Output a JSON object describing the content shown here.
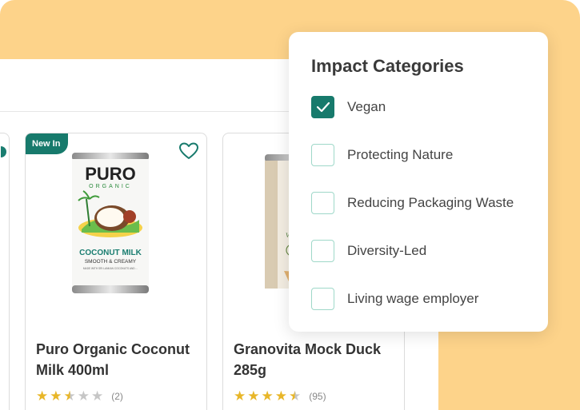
{
  "filter_popup": {
    "title": "Impact Categories",
    "options": [
      {
        "label": "Vegan",
        "checked": true
      },
      {
        "label": "Protecting Nature",
        "checked": false
      },
      {
        "label": "Reducing Packaging Waste",
        "checked": false
      },
      {
        "label": "Diversity-Led",
        "checked": false
      },
      {
        "label": "Living wage employer",
        "checked": false
      }
    ]
  },
  "products": [
    {
      "badge": "New In",
      "title_line1": "Puro Organic Coconut",
      "title_line2": "Milk 400ml",
      "rating": 2.5,
      "rating_count": "(2)",
      "can": {
        "brand": "PURO",
        "sub": "ORGANIC",
        "product": "COCONUT MILK",
        "tagline": "SMOOTH & CREAMY",
        "fineprint": "MADE WITH SRI LANKAN COCONUTS AND ..."
      }
    },
    {
      "title_line1": "Granovita Mock Duck",
      "title_line2": "285g",
      "rating": 4.5,
      "rating_count": "(95)",
      "can": {
        "label": "Vegan"
      }
    }
  ],
  "colors": {
    "accent": "#177a6c",
    "checkbox_border": "#9fd8c9",
    "background": "#fdd38a",
    "star": "#e8b628"
  },
  "icons": [
    "heart-icon",
    "check-icon",
    "star-icon"
  ]
}
